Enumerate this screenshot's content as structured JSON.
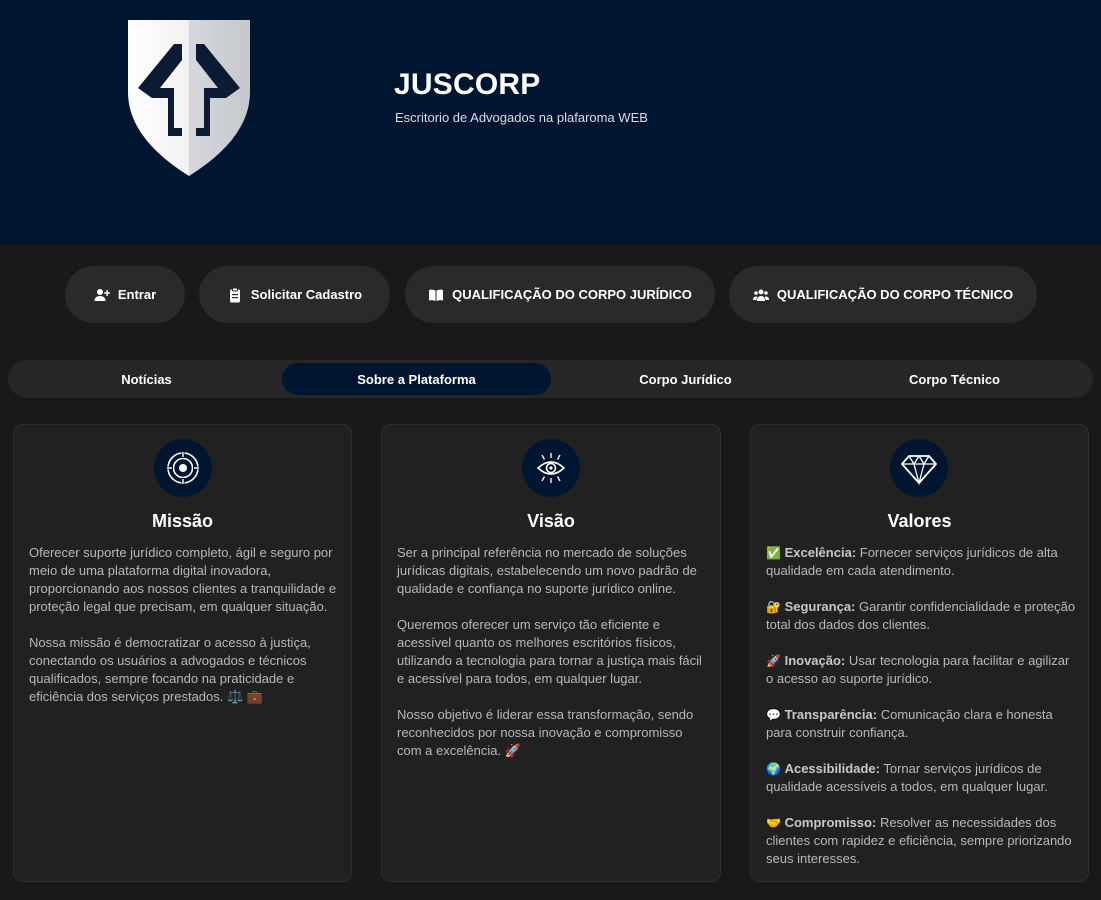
{
  "header": {
    "title": "JUSCORP",
    "subtitle": "Escritorio de Advogados na plafaroma WEB",
    "logo_icon": "shield-logo-icon"
  },
  "actions": [
    {
      "label": "Entrar",
      "icon": "user-plus-icon"
    },
    {
      "label": "Solicitar Cadastro",
      "icon": "clipboard-icon"
    },
    {
      "label": "QUALIFICAÇÃO DO CORPO JURÍDICO",
      "icon": "book-open-icon"
    },
    {
      "label": "QUALIFICAÇÃO DO CORPO TÉCNICO",
      "icon": "users-icon"
    }
  ],
  "tabs": [
    {
      "label": "Notícias",
      "active": false
    },
    {
      "label": "Sobre a Plataforma",
      "active": true
    },
    {
      "label": "Corpo Jurídico",
      "active": false
    },
    {
      "label": "Corpo Técnico",
      "active": false
    }
  ],
  "cards": {
    "missao": {
      "title": "Missão",
      "icon": "target-icon",
      "paragraphs": [
        "Oferecer suporte jurídico completo, ágil e seguro por meio de uma plataforma digital inovadora, proporcionando aos nossos clientes a tranquilidade e proteção legal que precisam, em qualquer situação.",
        "Nossa missão é democratizar o acesso à justiça, conectando os usuários a advogados e técnicos qualificados, sempre focando na praticidade e eficiência dos serviços prestados. ⚖️ 💼"
      ]
    },
    "visao": {
      "title": "Visão",
      "icon": "eye-icon",
      "paragraphs": [
        "Ser a principal referência no mercado de soluções jurídicas digitais, estabelecendo um novo padrão de qualidade e confiança no suporte jurídico online.",
        "Queremos oferecer um serviço tão eficiente e acessível quanto os melhores escritórios físicos, utilizando a tecnologia para tornar a justiça mais fácil e acessível para todos, em qualquer lugar.",
        "Nosso objetivo é liderar essa transformação, sendo reconhecidos por nossa inovação e compromisso com a excelência. 🚀"
      ]
    },
    "valores": {
      "title": "Valores",
      "icon": "diamond-icon",
      "items": [
        {
          "emoji": "✅",
          "name": "Excelência:",
          "text": "Fornecer serviços jurídicos de alta qualidade em cada atendimento."
        },
        {
          "emoji": "🔐",
          "name": "Segurança:",
          "text": "Garantir confidencialidade e proteção total dos dados dos clientes."
        },
        {
          "emoji": "🚀",
          "name": "Inovação:",
          "text": "Usar tecnologia para facilitar e agilizar o acesso ao suporte jurídico."
        },
        {
          "emoji": "💬",
          "name": "Transparência:",
          "text": "Comunicação clara e honesta para construir confiança."
        },
        {
          "emoji": "🌍",
          "name": "Acessibilidade:",
          "text": "Tornar serviços jurídicos de qualidade acessíveis a todos, em qualquer lugar."
        },
        {
          "emoji": "🤝",
          "name": "Compromisso:",
          "text": "Resolver as necessidades dos clientes com rapidez e eficiência, sempre priorizando seus interesses."
        }
      ]
    }
  },
  "colors": {
    "header_bg": "#001530",
    "page_bg": "#191919",
    "card_bg": "#212121",
    "button_bg": "#2a2a2a",
    "accent": "#001530"
  }
}
